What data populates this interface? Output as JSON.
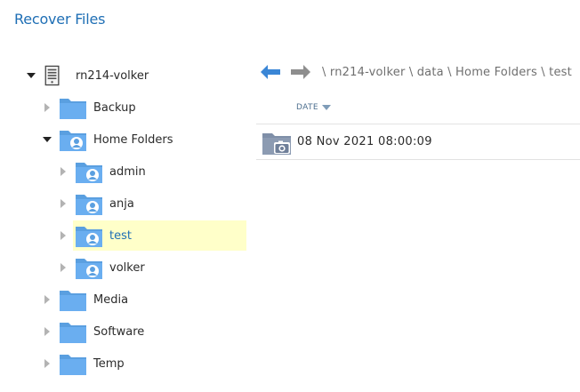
{
  "title": "Recover Files",
  "tree": {
    "root": {
      "label": "rn214-volker",
      "icon": "server-icon"
    },
    "items": [
      {
        "label": "Backup",
        "icon": "folder-icon"
      },
      {
        "label": "Home Folders",
        "icon": "user-folder-icon"
      },
      {
        "label": "admin",
        "icon": "user-folder-icon"
      },
      {
        "label": "anja",
        "icon": "user-folder-icon"
      },
      {
        "label": "test",
        "icon": "user-folder-icon"
      },
      {
        "label": "volker",
        "icon": "user-folder-icon"
      },
      {
        "label": "Media",
        "icon": "folder-icon"
      },
      {
        "label": "Software",
        "icon": "folder-icon"
      },
      {
        "label": "Temp",
        "icon": "folder-icon"
      }
    ]
  },
  "breadcrumb": "\\ rn214-volker \\ data \\ Home Folders \\ test",
  "table": {
    "column": "DATE",
    "rows": [
      {
        "date": "08 Nov 2021 08:00:09",
        "icon": "snapshot-folder-icon"
      }
    ]
  },
  "colors": {
    "accent": "#1f6fb5",
    "folder": "#5a9fe0",
    "selected_bg": "#ffffc9",
    "nav_back": "#3a86d6",
    "nav_forward": "#8e8e8e"
  }
}
